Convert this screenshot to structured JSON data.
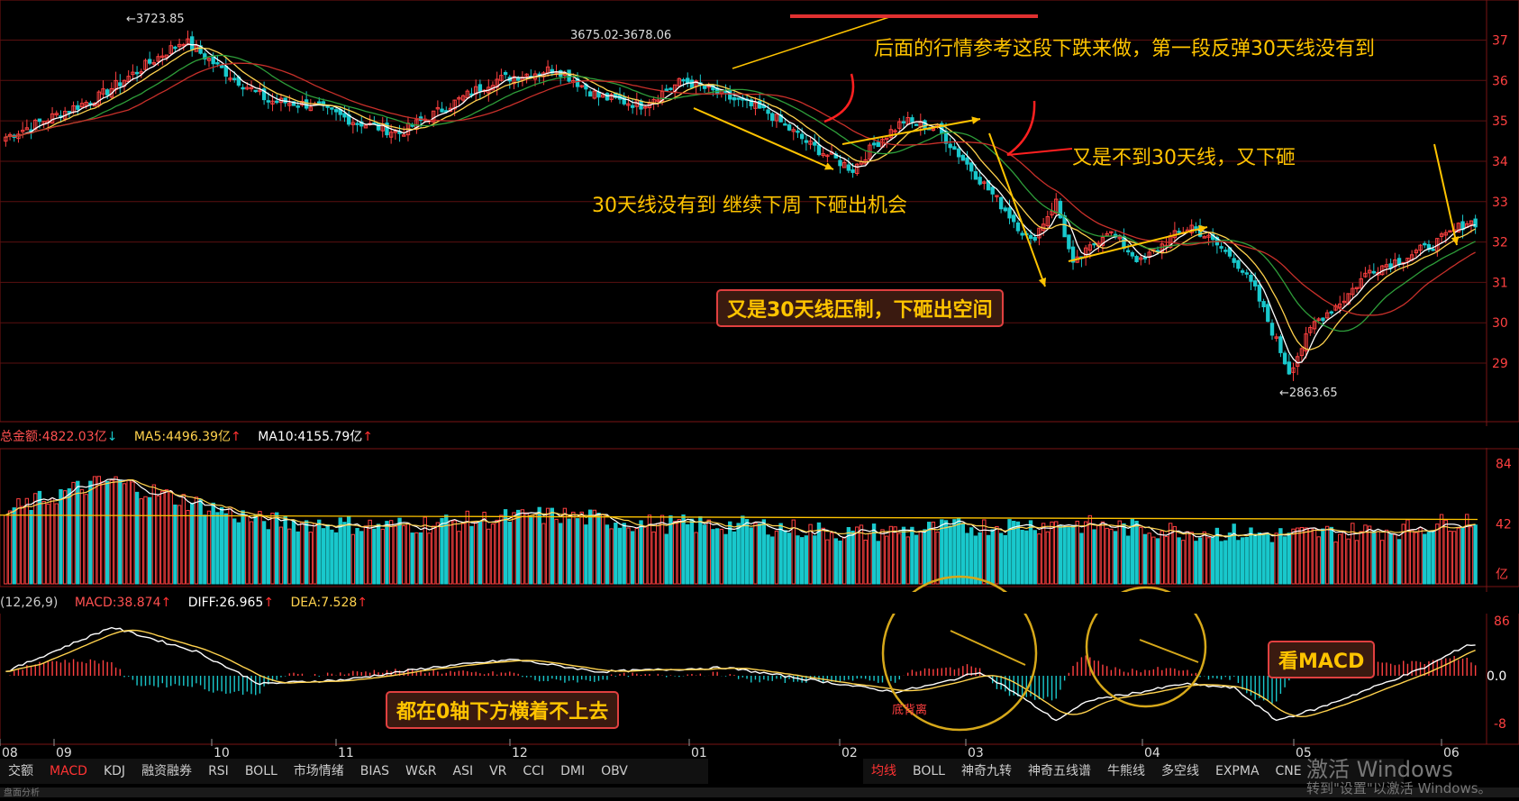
{
  "price_markers": {
    "high_1": "←3723.85",
    "high_2": "3675.02-3678.06",
    "low": "←2863.65"
  },
  "annotations": {
    "a1": "后面的行情参考这段下跌来做，第一段反弹30天线没有到",
    "a2": "又是不到30天线，又下砸",
    "a3": "30天线没有到  继续下周 下砸出机会",
    "a4": "又是30天线压制，下砸出空间",
    "a5": "都在0轴下方横着不上去",
    "a6": "看MACD",
    "a7": "底背离"
  },
  "volume_info": {
    "amount": "总金额:4822.03亿",
    "ma5": "MA5:4496.39亿",
    "ma10": "MA10:4155.79亿",
    "arrow_down": "↓",
    "arrow_up": "↑"
  },
  "macd_info": {
    "params": "(12,26,9)",
    "macd": "MACD:38.874",
    "diff": "DIFF:26.965",
    "dea": "DEA:7.528",
    "arrow_up": "↑"
  },
  "x_axis_labels": [
    "08",
    "09",
    "10",
    "11",
    "12",
    "01",
    "02",
    "03",
    "04",
    "05",
    "06"
  ],
  "price_axis_labels": [
    "37",
    "36",
    "35",
    "34",
    "33",
    "32",
    "31",
    "30",
    "29"
  ],
  "volume_axis_labels": [
    "84",
    "42",
    "亿"
  ],
  "macd_axis_labels": [
    "86",
    "0.0",
    "-8"
  ],
  "tabs_left": [
    "交额",
    "MACD",
    "KDJ",
    "融资融券",
    "RSI",
    "BOLL",
    "市场情绪",
    "BIAS",
    "W&R",
    "ASI",
    "VR",
    "CCI",
    "DMI",
    "OBV"
  ],
  "tabs_right": [
    "均线",
    "BOLL",
    "神奇九转",
    "神奇五线谱",
    "牛熊线",
    "多空线",
    "EXPMA",
    "CNE"
  ],
  "bottom_partial": "盘面分析",
  "watermark": {
    "line1": "激活 Windows",
    "line2": "转到\"设置\"以激活 Windows。"
  },
  "colors": {
    "up": "#ff4040",
    "down": "#19c8cc",
    "ma_white": "#ffffff",
    "ma_yellow": "#ffd24d",
    "ma_green": "#2e9e3a",
    "ma_red": "#c8302a",
    "annotation": "#ffc400",
    "grid": "#5a1010"
  },
  "chart_data": {
    "type": "candlestick",
    "title": "",
    "x_ticks": [
      "08",
      "09",
      "10",
      "11",
      "12",
      "01",
      "02",
      "03",
      "04",
      "05",
      "06"
    ],
    "y_ticks": [
      37,
      36,
      35,
      34,
      33,
      32,
      31,
      30,
      29
    ],
    "ylim": [
      2860,
      3760
    ],
    "price_keypoints": [
      [
        0,
        3460
      ],
      [
        22,
        3560
      ],
      [
        42,
        3700
      ],
      [
        52,
        3620
      ],
      [
        62,
        3550
      ],
      [
        72,
        3540
      ],
      [
        82,
        3500
      ],
      [
        93,
        3470
      ],
      [
        105,
        3540
      ],
      [
        115,
        3600
      ],
      [
        130,
        3630
      ],
      [
        140,
        3560
      ],
      [
        150,
        3540
      ],
      [
        160,
        3600
      ],
      [
        170,
        3560
      ],
      [
        180,
        3520
      ],
      [
        190,
        3440
      ],
      [
        200,
        3380
      ],
      [
        205,
        3440
      ],
      [
        212,
        3500
      ],
      [
        220,
        3480
      ],
      [
        228,
        3380
      ],
      [
        236,
        3280
      ],
      [
        242,
        3200
      ],
      [
        248,
        3300
      ],
      [
        252,
        3140
      ],
      [
        260,
        3230
      ],
      [
        268,
        3150
      ],
      [
        275,
        3210
      ],
      [
        280,
        3240
      ],
      [
        290,
        3160
      ],
      [
        295,
        3080
      ],
      [
        303,
        2880
      ],
      [
        309,
        3000
      ],
      [
        316,
        3060
      ],
      [
        322,
        3130
      ],
      [
        330,
        3160
      ],
      [
        338,
        3200
      ],
      [
        345,
        3250
      ]
    ],
    "ma_lines": [
      "MA5",
      "MA10",
      "MA20",
      "MA30"
    ],
    "volume_keypoints": [
      [
        0,
        50
      ],
      [
        15,
        65
      ],
      [
        25,
        72
      ],
      [
        40,
        60
      ],
      [
        60,
        44
      ],
      [
        90,
        40
      ],
      [
        110,
        44
      ],
      [
        130,
        48
      ],
      [
        150,
        42
      ],
      [
        180,
        40
      ],
      [
        200,
        35
      ],
      [
        230,
        40
      ],
      [
        250,
        42
      ],
      [
        270,
        38
      ],
      [
        300,
        34
      ],
      [
        330,
        38
      ],
      [
        345,
        45
      ]
    ],
    "macd_keypoints": [
      [
        0,
        5
      ],
      [
        25,
        60
      ],
      [
        45,
        30
      ],
      [
        60,
        -10
      ],
      [
        80,
        -5
      ],
      [
        100,
        10
      ],
      [
        120,
        20
      ],
      [
        140,
        5
      ],
      [
        170,
        10
      ],
      [
        190,
        -5
      ],
      [
        210,
        -20
      ],
      [
        220,
        -10
      ],
      [
        230,
        5
      ],
      [
        238,
        -20
      ],
      [
        248,
        -55
      ],
      [
        256,
        -30
      ],
      [
        268,
        -20
      ],
      [
        278,
        -10
      ],
      [
        290,
        -15
      ],
      [
        300,
        -55
      ],
      [
        310,
        -40
      ],
      [
        320,
        -20
      ],
      [
        335,
        10
      ],
      [
        345,
        38
      ]
    ]
  }
}
